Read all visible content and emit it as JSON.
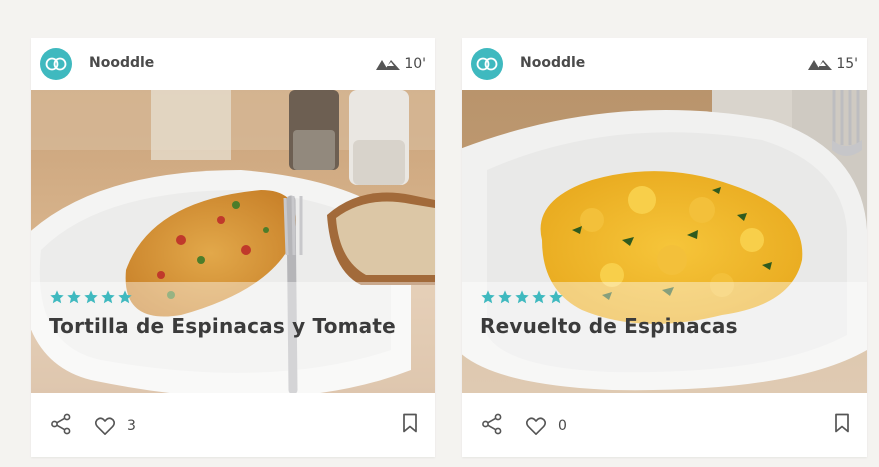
{
  "colors": {
    "accent": "#3fb9bf",
    "text": "#4a4a4a",
    "background": "#f4f3f0"
  },
  "cards": [
    {
      "author": "Nooddle",
      "author_icon": "nooddle-logo-icon",
      "difficulty_icon": "difficulty-icon",
      "time": "10'",
      "rating_stars": 5,
      "title": "Tortilla de Espinacas y Tomate",
      "likes": "3",
      "image": "spinach-tomato-omelette-photo"
    },
    {
      "author": "Nooddle",
      "author_icon": "nooddle-logo-icon",
      "difficulty_icon": "difficulty-icon",
      "time": "15'",
      "rating_stars": 5,
      "title": "Revuelto de Espinacas",
      "likes": "0",
      "image": "scrambled-eggs-spinach-photo"
    }
  ]
}
